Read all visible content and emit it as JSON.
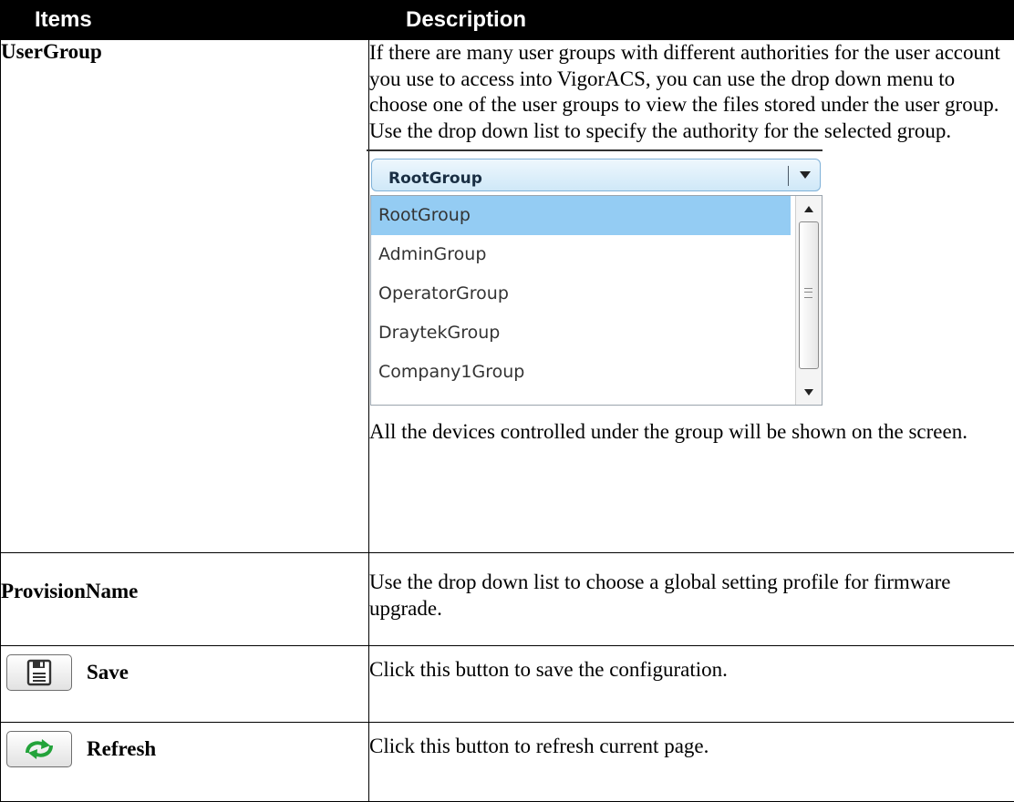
{
  "header": {
    "items": "Items",
    "description": "Description"
  },
  "rows": [
    {
      "item": "UserGroup",
      "desc_before": "If there are many user groups with different authorities for the user account you use to access into VigorACS, you can use the drop down menu to choose one of the user groups to view the files stored under the user group. Use the drop down list to specify the authority for the selected group.",
      "dropdown": {
        "selected": "RootGroup",
        "options": [
          "RootGroup",
          "AdminGroup",
          "OperatorGroup",
          "DraytekGroup",
          "Company1Group"
        ]
      },
      "desc_after": "All the devices controlled under the group will be shown on the screen."
    },
    {
      "item": "ProvisionName",
      "desc": "Use the drop down list to choose a global setting profile for firmware upgrade."
    },
    {
      "item": "Save",
      "icon": "save-icon",
      "desc": "Click this button to save the configuration."
    },
    {
      "item": "Refresh",
      "icon": "refresh-icon",
      "desc": "Click this button to refresh current page."
    }
  ],
  "colors": {
    "header_bg": "#000000",
    "selected_option": "#94ccf3",
    "refresh_icon": "#23a33a"
  }
}
